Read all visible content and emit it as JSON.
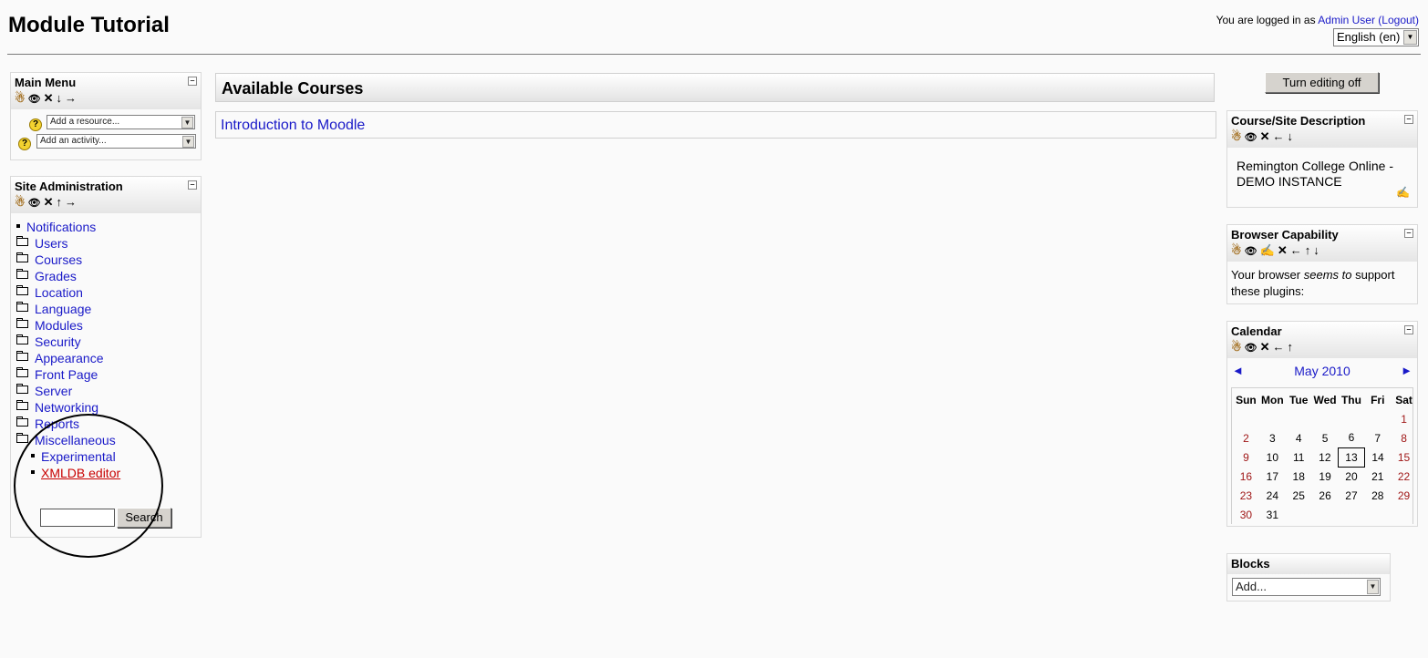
{
  "header": {
    "site_title": "Module Tutorial",
    "logged_in_prefix": "You are logged in as ",
    "user_name": "Admin User",
    "logout_label": "(Logout)",
    "language": "English (en)"
  },
  "main_menu": {
    "title": "Main Menu",
    "add_resource_placeholder": "Add a resource...",
    "add_activity_placeholder": "Add an activity..."
  },
  "site_admin": {
    "title": "Site Administration",
    "items": [
      {
        "label": "Notifications",
        "type": "item"
      },
      {
        "label": "Users",
        "type": "folder"
      },
      {
        "label": "Courses",
        "type": "folder"
      },
      {
        "label": "Grades",
        "type": "folder"
      },
      {
        "label": "Location",
        "type": "folder"
      },
      {
        "label": "Language",
        "type": "folder"
      },
      {
        "label": "Modules",
        "type": "folder"
      },
      {
        "label": "Security",
        "type": "folder"
      },
      {
        "label": "Appearance",
        "type": "folder"
      },
      {
        "label": "Front Page",
        "type": "folder"
      },
      {
        "label": "Server",
        "type": "folder"
      },
      {
        "label": "Networking",
        "type": "folder"
      },
      {
        "label": "Reports",
        "type": "folder"
      },
      {
        "label": "Miscellaneous",
        "type": "folder-open"
      }
    ],
    "sub_items": [
      "Experimental",
      "XMLDB editor"
    ],
    "search_button": "Search"
  },
  "center": {
    "available_courses_title": "Available Courses",
    "courses": [
      "Introduction to Moodle"
    ]
  },
  "right": {
    "editing_button": "Turn editing off",
    "course_desc": {
      "title": "Course/Site Description",
      "text": "Remington College Online - DEMO INSTANCE"
    },
    "browser_cap": {
      "title": "Browser Capability",
      "text_before": "Your browser ",
      "text_em": "seems to",
      "text_after": " support these plugins:"
    },
    "calendar": {
      "title": "Calendar",
      "month": "May 2010",
      "prev": "◄",
      "next": "►",
      "days": [
        "Sun",
        "Mon",
        "Tue",
        "Wed",
        "Thu",
        "Fri",
        "Sat"
      ],
      "weeks": [
        [
          "",
          "",
          "",
          "",
          "",
          "",
          "1"
        ],
        [
          "2",
          "3",
          "4",
          "5",
          "6",
          "7",
          "8"
        ],
        [
          "9",
          "10",
          "11",
          "12",
          "13",
          "14",
          "15"
        ],
        [
          "16",
          "17",
          "18",
          "19",
          "20",
          "21",
          "22"
        ],
        [
          "23",
          "24",
          "25",
          "26",
          "27",
          "28",
          "29"
        ],
        [
          "30",
          "31",
          "",
          "",
          "",
          "",
          ""
        ]
      ],
      "today": "13"
    },
    "blocks": {
      "title": "Blocks",
      "add_label": "Add..."
    }
  },
  "icons": {
    "roles": "roles-icon",
    "hide": "eye-icon",
    "delete": "delete-x-icon",
    "move_down": "arrow-down-icon",
    "move_up": "arrow-up-icon",
    "move_left": "arrow-left-icon",
    "move_right": "arrow-right-icon",
    "edit": "edit-pen-icon",
    "collapse": "collapse-icon",
    "help": "help-icon",
    "folder": "folder-icon"
  },
  "colors": {
    "link": "#1a1ac8",
    "weekend": "#a01818",
    "xmldb_link": "#c80000"
  }
}
